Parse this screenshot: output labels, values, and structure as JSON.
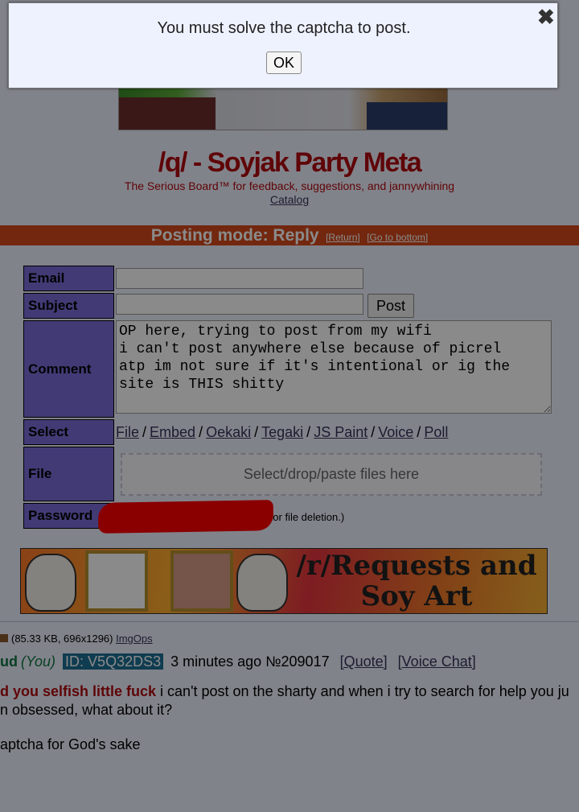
{
  "dialog": {
    "message": "You must solve the captcha to post.",
    "ok_label": "OK",
    "close_glyph": "✖"
  },
  "board": {
    "title": "/q/ - Soyjak Party Meta",
    "subtitle": "The Serious Board™ for feedback, suggestions, and jannywhining",
    "catalog_link": "Catalog"
  },
  "mode_bar": {
    "title": "Posting mode: Reply",
    "return_link": "[Return]",
    "bottom_link": "[Go to bottom]"
  },
  "form": {
    "email_label": "Email",
    "email_value": "",
    "subject_label": "Subject",
    "subject_value": "",
    "post_button": "Post",
    "comment_label": "Comment",
    "comment_value": "OP here, trying to post from my wifi\ni can't post anywhere else because of picrel\natp im not sure if it's intentional or ig the\nsite is THIS shitty",
    "select_label": "Select",
    "select_options": [
      "File",
      "Embed",
      "Oekaki",
      "Tegaki",
      "JS Paint",
      "Voice",
      "Poll"
    ],
    "file_label": "File",
    "dropzone_text": "Select/drop/paste files here",
    "password_label": "Password",
    "password_note": "(For file deletion.)"
  },
  "ad_banner": {
    "line1": "/r/Requests and",
    "line2": "Soy Art"
  },
  "post": {
    "file_info": "(85.33 KB, 696x1296)",
    "imgops_link": "ImgOps",
    "name": "ud",
    "you_tag": "(You)",
    "id": "ID: V5Q32DS3",
    "time": "3 minutes ago",
    "number": "№209017",
    "quote_link": "[Quote]",
    "voice_link": "[Voice Chat]",
    "subject": "d you selfish little fuck",
    "body_line1": " i can't post on the sharty and when i try to search for help you ju",
    "body_line2": "n obsessed, what about it?",
    "body_line3": "aptcha for God's sake"
  },
  "colors": {
    "accent": "#d2491a",
    "label_bg": "#7a6cd9",
    "board_title": "#af0a0f",
    "id_badge": "#1d6f94",
    "redaction": "#ff0000"
  }
}
